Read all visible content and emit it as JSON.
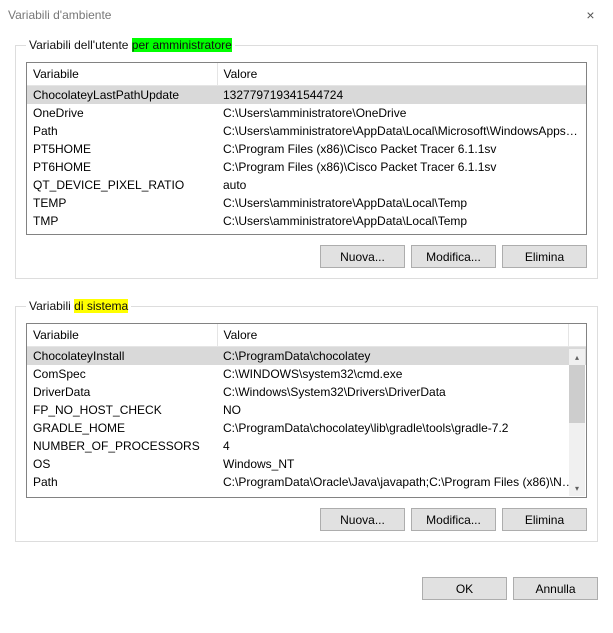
{
  "window": {
    "title": "Variabili d'ambiente",
    "close": "×"
  },
  "user_section": {
    "legend_prefix": "Variabili dell'utente ",
    "legend_highlight": "per amministratore",
    "col_var": "Variabile",
    "col_val": "Valore",
    "rows": [
      {
        "var": "ChocolateyLastPathUpdate",
        "val": "132779719341544724",
        "selected": true
      },
      {
        "var": "OneDrive",
        "val": "C:\\Users\\amministratore\\OneDrive",
        "selected": false
      },
      {
        "var": "Path",
        "val": "C:\\Users\\amministratore\\AppData\\Local\\Microsoft\\WindowsApps;;C:\\...",
        "selected": false
      },
      {
        "var": "PT5HOME",
        "val": "C:\\Program Files (x86)\\Cisco Packet Tracer 6.1.1sv",
        "selected": false
      },
      {
        "var": "PT6HOME",
        "val": "C:\\Program Files (x86)\\Cisco Packet Tracer 6.1.1sv",
        "selected": false
      },
      {
        "var": "QT_DEVICE_PIXEL_RATIO",
        "val": "auto",
        "selected": false
      },
      {
        "var": "TEMP",
        "val": "C:\\Users\\amministratore\\AppData\\Local\\Temp",
        "selected": false
      },
      {
        "var": "TMP",
        "val": "C:\\Users\\amministratore\\AppData\\Local\\Temp",
        "selected": false
      }
    ],
    "btn_new": "Nuova...",
    "btn_edit": "Modifica...",
    "btn_del": "Elimina"
  },
  "sys_section": {
    "legend_prefix": "Variabili ",
    "legend_highlight": "di sistema",
    "col_var": "Variabile",
    "col_val": "Valore",
    "rows": [
      {
        "var": "ChocolateyInstall",
        "val": "C:\\ProgramData\\chocolatey",
        "selected": true
      },
      {
        "var": "ComSpec",
        "val": "C:\\WINDOWS\\system32\\cmd.exe",
        "selected": false
      },
      {
        "var": "DriverData",
        "val": "C:\\Windows\\System32\\Drivers\\DriverData",
        "selected": false
      },
      {
        "var": "FP_NO_HOST_CHECK",
        "val": "NO",
        "selected": false
      },
      {
        "var": "GRADLE_HOME",
        "val": "C:\\ProgramData\\chocolatey\\lib\\gradle\\tools\\gradle-7.2",
        "selected": false
      },
      {
        "var": "NUMBER_OF_PROCESSORS",
        "val": "4",
        "selected": false
      },
      {
        "var": "OS",
        "val": "Windows_NT",
        "selected": false
      },
      {
        "var": "Path",
        "val": "C:\\ProgramData\\Oracle\\Java\\javapath;C:\\Program Files (x86)\\NVIDI...",
        "selected": false
      }
    ],
    "btn_new": "Nuova...",
    "btn_edit": "Modifica...",
    "btn_del": "Elimina"
  },
  "dialog": {
    "ok": "OK",
    "cancel": "Annulla"
  },
  "scroll": {
    "up": "▴",
    "down": "▾"
  }
}
